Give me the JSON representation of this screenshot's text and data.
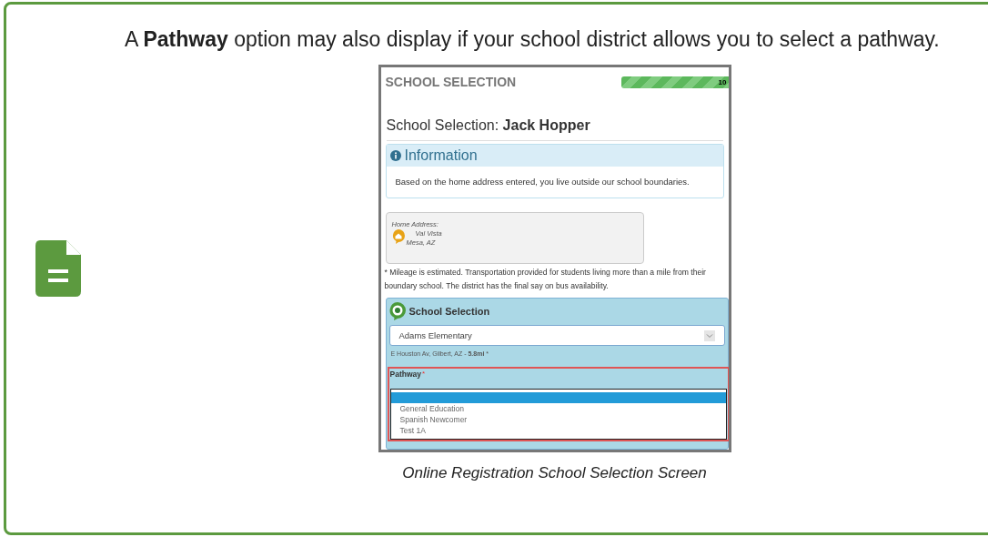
{
  "note": {
    "text": "A **Pathway** option may also display if your school district allows you to select a pathway."
  },
  "screenshot": {
    "header": "SCHOOL SELECTION",
    "progress": {
      "level": 1,
      "reading": "10"
    },
    "title": "School Selection: ",
    "student": "Jack Hopper",
    "info": {
      "heading": "Information",
      "message": "Based on the home address entered, you live outside our school boundaries."
    },
    "address": {
      "label": "Home Address:",
      "line_1": "Val Vista",
      "line_2": "Mesa, AZ"
    },
    "mileage_note": "* Mileage is estimated. Transportation provided for students living more than a mile from their boundary school. The district has the final say on bus availability.",
    "school_selection": {
      "heading": "School Selection",
      "value": "Adams Elementary",
      "school_address": "E Houston Av, Gilbert, AZ - **5.8mi** *"
    },
    "pathway": {
      "label": "Pathway",
      "required_mark": "*",
      "options": [
        {
          "selected": true
        },
        {
          "label": "General Education",
          "selected": false
        },
        {
          "label": "Spanish Newcomer",
          "selected": false
        },
        {
          "label": "Test 1A",
          "selected": false
        }
      ]
    }
  },
  "caption": "Online Registration School Selection Screen"
}
